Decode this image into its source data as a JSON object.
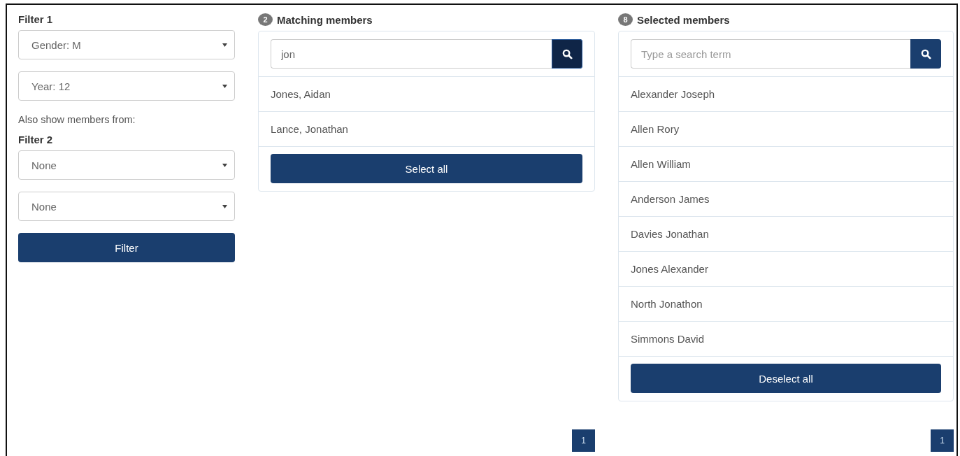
{
  "filters": [
    {
      "title": "Filter 1",
      "selects": [
        "Gender: M",
        "Year: 12"
      ]
    },
    {
      "note": "Also show members from:",
      "title": "Filter 2",
      "selects": [
        "None",
        "None"
      ]
    }
  ],
  "filter_button": "Filter",
  "panels": [
    {
      "count": "2",
      "title": "Matching members",
      "search": {
        "value": "jon",
        "button_focused": true
      },
      "items": [
        "Jones, Aidan",
        "Lance, Jonathan"
      ],
      "button": "Select all",
      "page": "1"
    },
    {
      "count": "8",
      "title": "Selected members",
      "search": {
        "placeholder": "Type a search term",
        "button_focused": false
      },
      "items": [
        "Alexander Joseph",
        "Allen Rory",
        "Allen William",
        "Anderson James",
        "Davies Jonathan",
        "Jones Alexander",
        "North Jonathon",
        "Simmons David"
      ],
      "button": "Deselect all",
      "page": "1"
    }
  ]
}
